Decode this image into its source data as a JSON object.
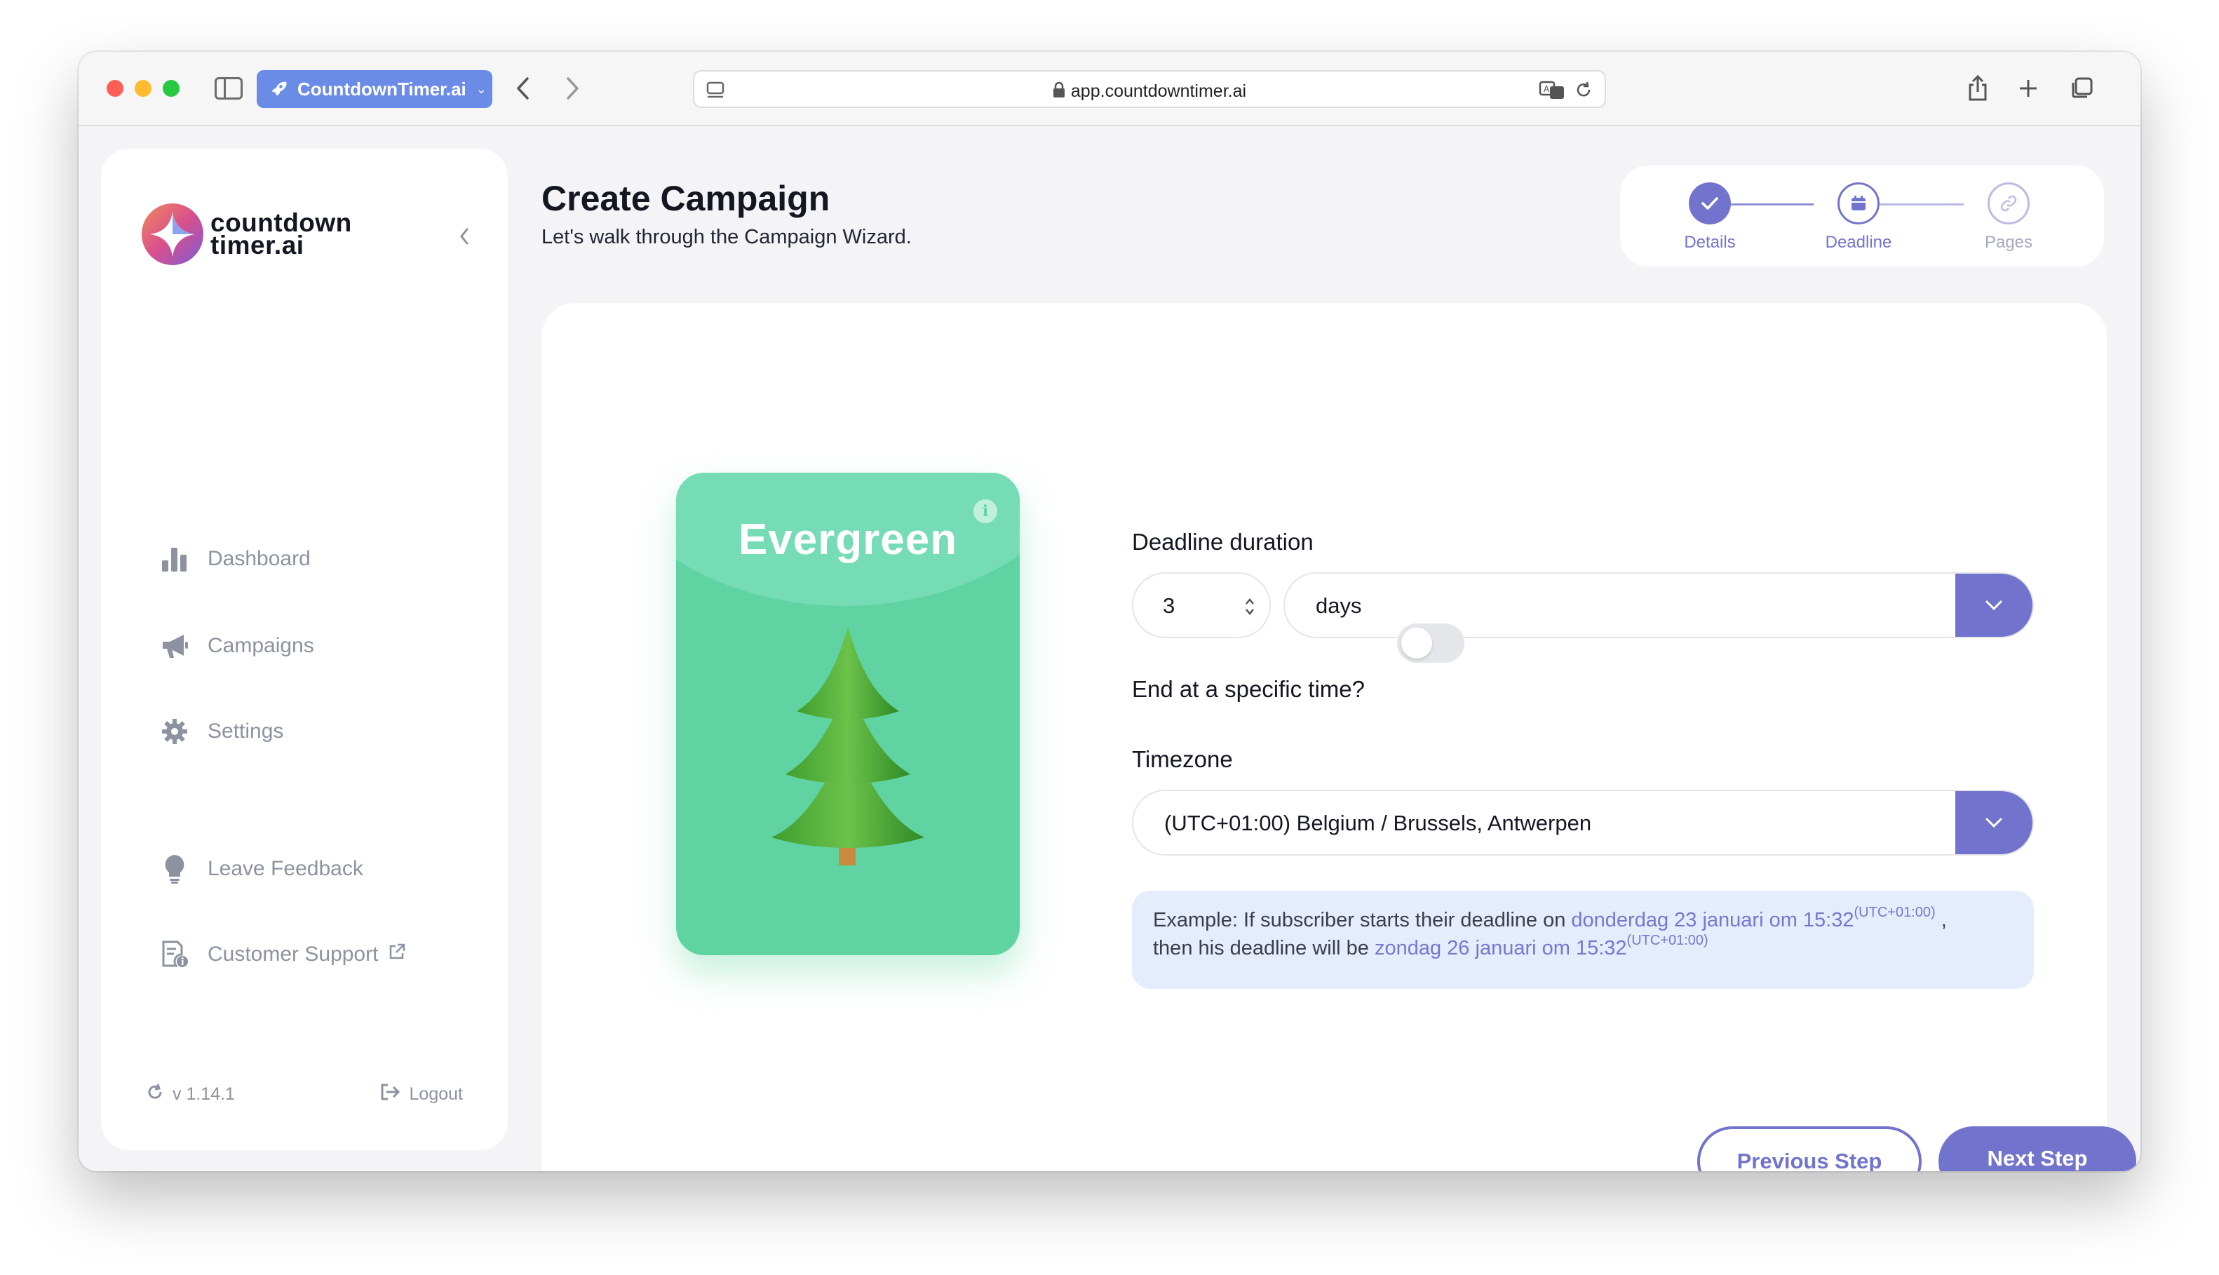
{
  "browser": {
    "tab_group_label": "CountdownTimer.ai",
    "url": "app.countdowntimer.ai"
  },
  "sidebar": {
    "logo_line1": "countdown",
    "logo_line2": "timer.ai",
    "items": [
      {
        "label": "Dashboard",
        "icon": "bar-chart-icon"
      },
      {
        "label": "Campaigns",
        "icon": "megaphone-icon"
      },
      {
        "label": "Settings",
        "icon": "gear-icon"
      },
      {
        "label": "Leave Feedback",
        "icon": "lightbulb-icon"
      },
      {
        "label": "Customer Support",
        "icon": "support-document-icon"
      }
    ],
    "version": "v 1.14.1",
    "logout_label": "Logout"
  },
  "header": {
    "title": "Create Campaign",
    "subtitle": "Let's walk through the Campaign Wizard."
  },
  "stepper": {
    "steps": [
      {
        "label": "Details",
        "state": "complete"
      },
      {
        "label": "Deadline",
        "state": "active"
      },
      {
        "label": "Pages",
        "state": "upcoming"
      }
    ]
  },
  "campaign_type": {
    "title": "Evergreen"
  },
  "form": {
    "duration_label": "Deadline duration",
    "duration_value": "3",
    "duration_unit": "days",
    "end_specific_time_label": "End at a specific time?",
    "end_specific_time_enabled": false,
    "timezone_label": "Timezone",
    "timezone_value": "(UTC+01:00) Belgium / Brussels, Antwerpen"
  },
  "example": {
    "prefix": "Example: If subscriber starts their deadline on ",
    "start_date": "donderdag 23 januari om 15:32",
    "start_tz": "(UTC+01:00)",
    "middle": " ,",
    "line2_prefix": "then his deadline will be ",
    "end_date": "zondag 26 januari om 15:32",
    "end_tz": "(UTC+01:00)"
  },
  "buttons": {
    "previous_label": "Previous Step",
    "next_label": "Next Step"
  },
  "colors": {
    "accent": "#7273cc",
    "evergreen": "#5fd3a1",
    "example_bg": "#e5ecfb"
  }
}
